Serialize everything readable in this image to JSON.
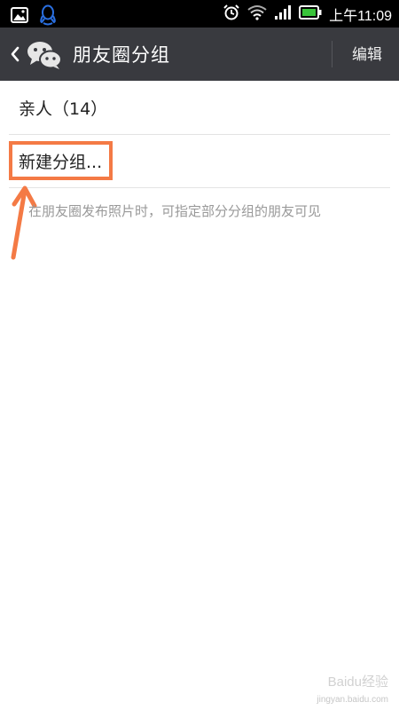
{
  "status_bar": {
    "time": "上午11:09",
    "icons": [
      "gallery-icon",
      "qq-icon",
      "alarm-icon",
      "wifi-icon",
      "signal-icon",
      "battery-icon"
    ]
  },
  "header": {
    "title": "朋友圈分组",
    "edit_label": "编辑",
    "icons": [
      "back-chevron-icon",
      "wechat-logo-icon"
    ]
  },
  "groups": [
    {
      "label": "亲人（14）"
    }
  ],
  "new_group_label": "新建分组...",
  "hint": "在朋友圈发布照片时，可指定部分分组的朋友可见",
  "watermark": "Baidu经验",
  "watermark_url": "jingyan.baidu.com",
  "colors": {
    "status_bar": "#000000",
    "title_bar": "#393a3f",
    "highlight": "#f47a45",
    "hint_text": "#999999",
    "divider": "#e3e3e3"
  }
}
